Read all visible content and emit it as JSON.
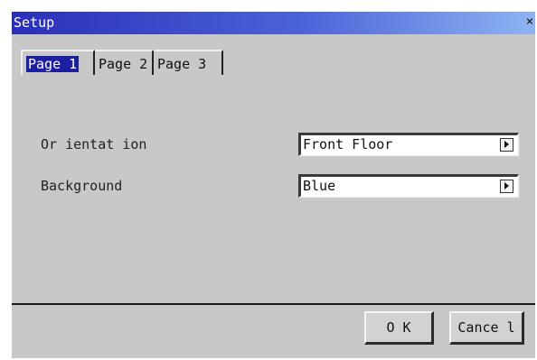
{
  "window": {
    "title": "Setup",
    "close_glyph": "×"
  },
  "tabs": [
    {
      "label": "Page 1",
      "selected": true
    },
    {
      "label": "Page 2",
      "selected": false
    },
    {
      "label": "Page 3",
      "selected": false
    }
  ],
  "fields": {
    "orientation": {
      "label": "Or ientat ion",
      "value": "Front Floor",
      "icon": "dropdown-arrow-icon"
    },
    "background": {
      "label": "Background",
      "value": "Blue",
      "icon": "dropdown-arrow-icon"
    }
  },
  "buttons": {
    "ok": "O  K",
    "cancel": "Cance l"
  },
  "colors": {
    "title_bar_start": "#2b2fb8",
    "title_bar_end": "#8fb4f2",
    "dialog_bg": "#c8c8c8",
    "tab_selected_bg": "#1b1fa0"
  }
}
